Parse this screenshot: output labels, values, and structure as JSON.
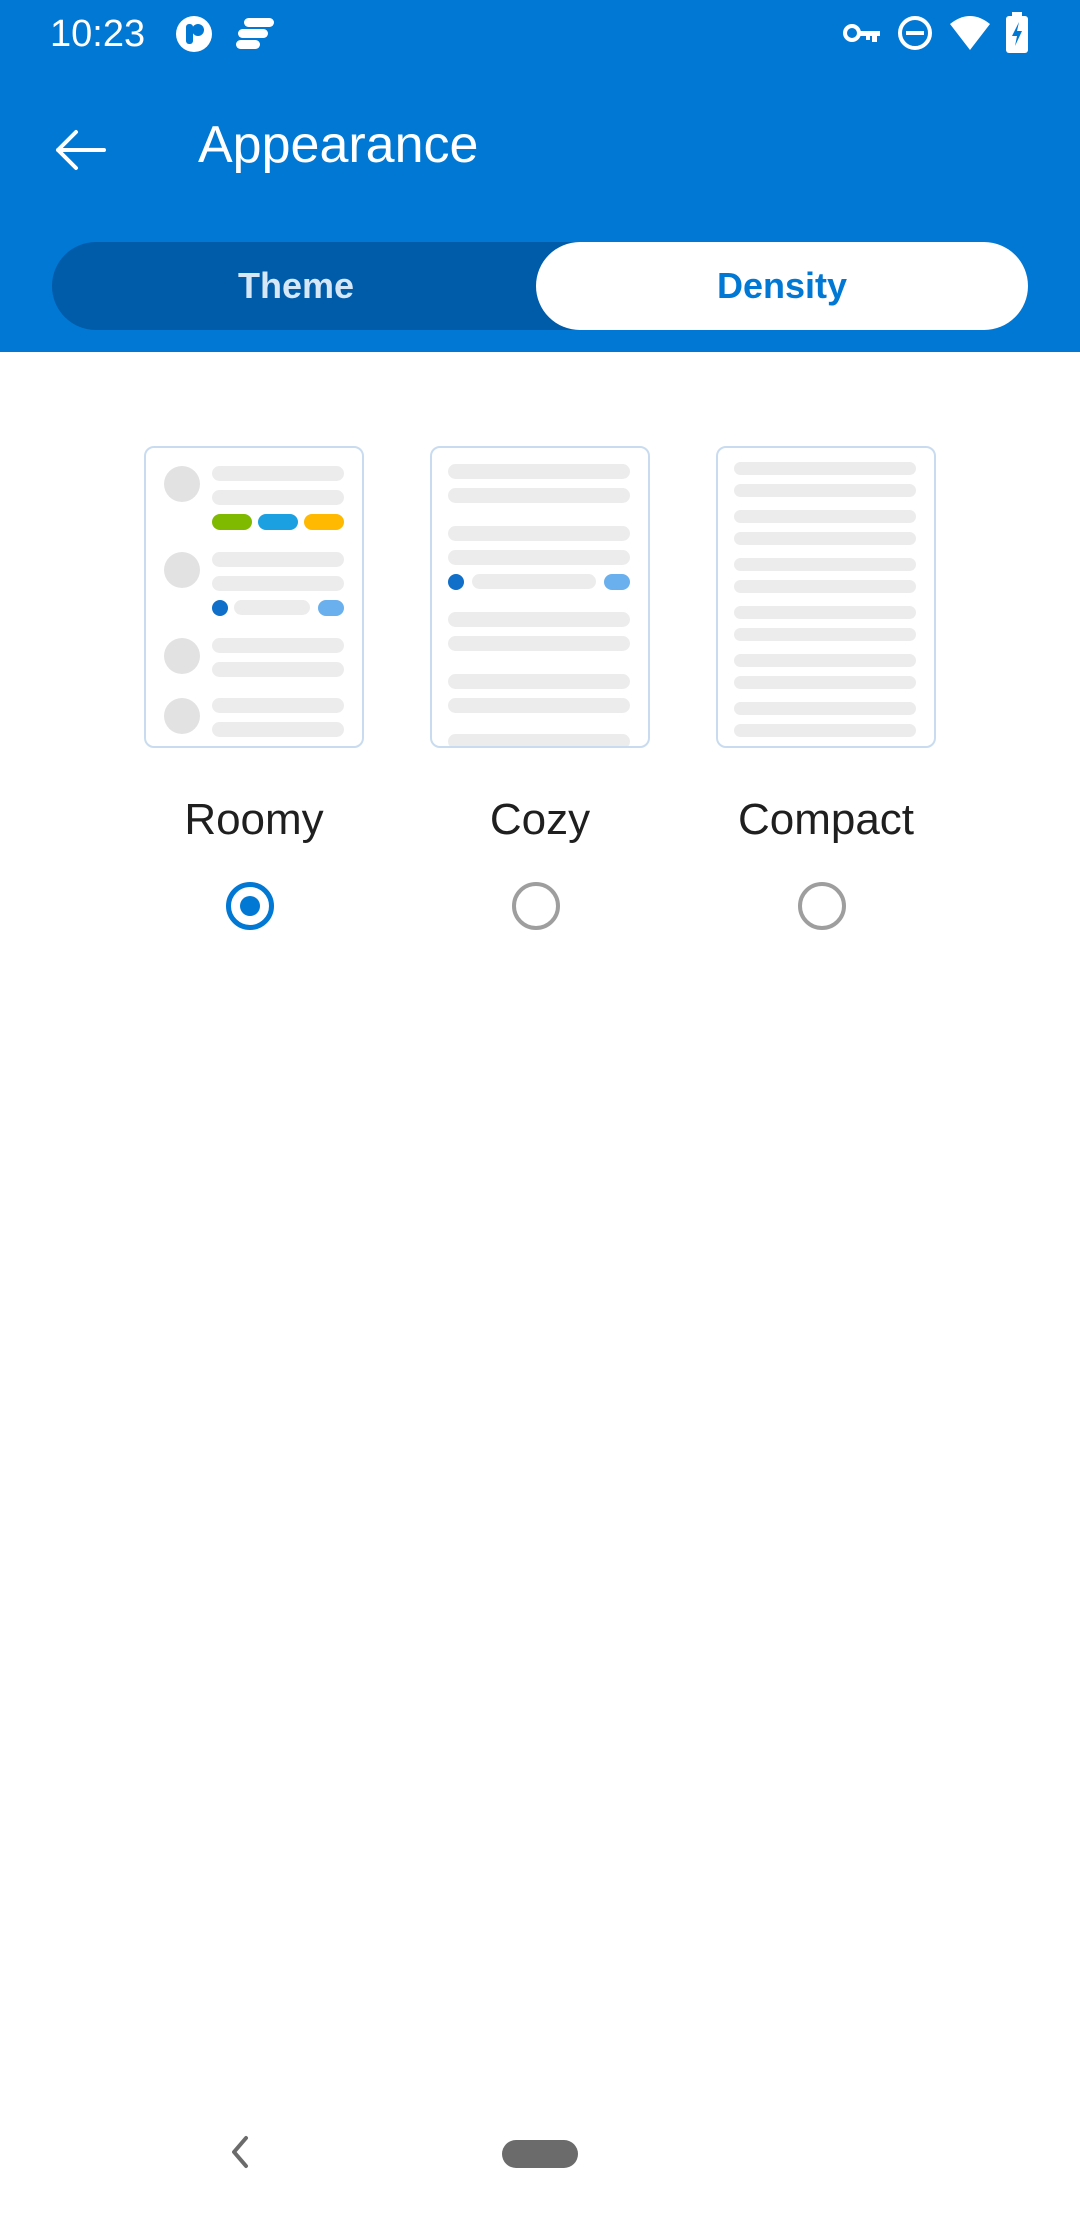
{
  "status_bar": {
    "time": "10:23",
    "left_icons": [
      "app-icon",
      "app-icon-2"
    ],
    "right_icons": [
      "vpn-key-icon",
      "do-not-disturb-icon",
      "wifi-icon",
      "battery-charging-icon"
    ]
  },
  "header": {
    "title": "Appearance",
    "back_icon": "arrow-left-icon"
  },
  "tabs": [
    {
      "label": "Theme",
      "selected": false
    },
    {
      "label": "Density",
      "selected": true
    }
  ],
  "density_options": [
    {
      "label": "Roomy",
      "selected": true
    },
    {
      "label": "Cozy",
      "selected": false
    },
    {
      "label": "Compact",
      "selected": false
    }
  ],
  "colors": {
    "accent": "#0078d4",
    "segment_bg": "#005ba8",
    "tag_green": "#7fba00",
    "tag_blue": "#1ba1e2",
    "tag_yellow": "#ffb900"
  },
  "nav_bar": {
    "icons": [
      "nav-back-icon",
      "nav-home-pill"
    ]
  }
}
